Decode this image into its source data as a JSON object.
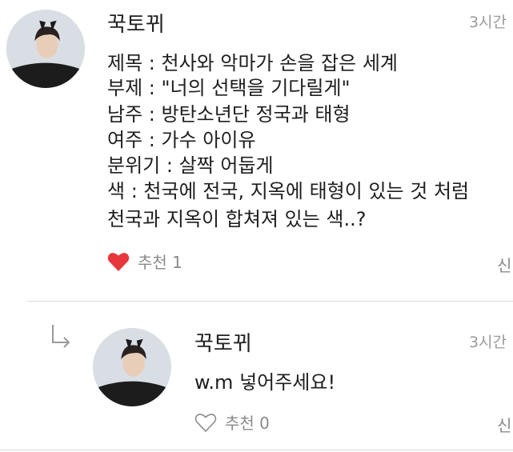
{
  "comment": {
    "author": "꾹토뀌",
    "time": "3시간",
    "lines": [
      "제목 : 천사와 악마가 손을 잡은 세계",
      "부제 : \"너의 선택을 기다릴게\"",
      "남주 : 방탄소년단 정국과 태형",
      "여주 : 가수 아이유",
      "분위기 : 살짝 어둡게",
      "색 : 천국에 전국, 지옥에 태형이 있는 것 처럼",
      "천국과 지옥이 합쳐져 있는 색..?"
    ],
    "like_label": "추천 1",
    "report_label": "신",
    "liked": true,
    "heart_color": "#e8373c"
  },
  "reply": {
    "author": "꾹토뀌",
    "time": "3시간",
    "text": "w.m 넣어주세요!",
    "like_label": "추천 0",
    "report_label": "신",
    "liked": false
  }
}
